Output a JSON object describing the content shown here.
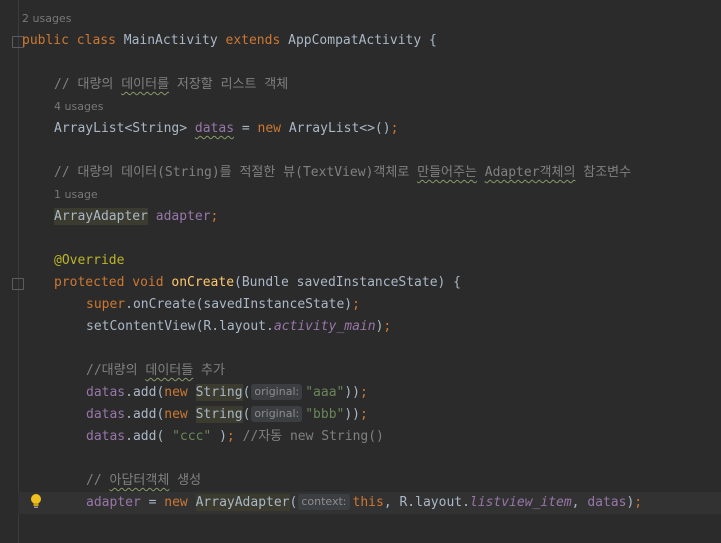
{
  "editor": {
    "lines": [
      {
        "id": "class-usages",
        "text": "2 usages"
      },
      {
        "id": "class-decl",
        "tokens": [
          {
            "t": "public class ",
            "c": "kw"
          },
          {
            "t": "MainActivity ",
            "c": "cls"
          },
          {
            "t": "extends ",
            "c": "kw"
          },
          {
            "t": "AppCompatActivity {",
            "c": "cls"
          }
        ]
      },
      {
        "id": "comment-1",
        "tokens": [
          {
            "t": "// 대량의 ",
            "c": "comment"
          },
          {
            "t": "데이터를",
            "c": "comment squig"
          },
          {
            "t": " 저장할 리스트 객체",
            "c": "comment"
          }
        ]
      },
      {
        "id": "datas-usages",
        "text": "4 usages"
      },
      {
        "id": "datas-decl",
        "tokens": [
          {
            "t": "ArrayList<String> ",
            "c": "cls"
          },
          {
            "t": "datas",
            "c": "field squig"
          },
          {
            "t": " = ",
            "c": "cls"
          },
          {
            "t": "new ",
            "c": "kw"
          },
          {
            "t": "ArrayList<>()",
            "c": "cls"
          },
          {
            "t": ";",
            "c": "kw"
          }
        ]
      },
      {
        "id": "comment-2",
        "tokens": [
          {
            "t": "// 대량의 데이터(String)를 적절한 뷰(TextView)객체로 ",
            "c": "comment"
          },
          {
            "t": "만들어주는",
            "c": "comment squig"
          },
          {
            "t": " ",
            "c": "comment"
          },
          {
            "t": "Adapter객체의",
            "c": "comment squig"
          },
          {
            "t": " 참조변수",
            "c": "comment"
          }
        ]
      },
      {
        "id": "adapter-usages",
        "text": "1 usage"
      },
      {
        "id": "adapter-decl",
        "tokens": [
          {
            "t": "ArrayAdapter",
            "c": "cls hl"
          },
          {
            "t": " ",
            "c": "cls"
          },
          {
            "t": "adapter",
            "c": "field"
          },
          {
            "t": ";",
            "c": "kw"
          }
        ]
      },
      {
        "id": "override",
        "tokens": [
          {
            "t": "@Override",
            "c": "ann"
          }
        ]
      },
      {
        "id": "oncreate-decl",
        "tokens": [
          {
            "t": "protected void ",
            "c": "kw"
          },
          {
            "t": "onCreate",
            "c": "method"
          },
          {
            "t": "(Bundle savedInstanceState) {",
            "c": "cls"
          }
        ]
      },
      {
        "id": "super-call",
        "tokens": [
          {
            "t": "super",
            "c": "kw"
          },
          {
            "t": ".onCreate(savedInstanceState)",
            "c": "cls"
          },
          {
            "t": ";",
            "c": "kw"
          }
        ]
      },
      {
        "id": "set-content",
        "tokens": [
          {
            "t": "setContentView(R.layout.",
            "c": "cls"
          },
          {
            "t": "activity_main",
            "c": "field ital"
          },
          {
            "t": ")",
            "c": "cls"
          },
          {
            "t": ";",
            "c": "kw"
          }
        ]
      },
      {
        "id": "comment-3",
        "tokens": [
          {
            "t": "//대량의 ",
            "c": "comment"
          },
          {
            "t": "데이터들",
            "c": "comment squig"
          },
          {
            "t": " 추가",
            "c": "comment"
          }
        ]
      },
      {
        "id": "add-aaa",
        "tokens": [
          {
            "t": "datas",
            "c": "field"
          },
          {
            "t": ".add(",
            "c": "cls"
          },
          {
            "t": "new ",
            "c": "kw"
          },
          {
            "t": "String",
            "c": "cls hl"
          },
          {
            "t": "(",
            "c": "cls"
          },
          {
            "hint": "original:"
          },
          {
            "t": "\"aaa\"",
            "c": "str"
          },
          {
            "t": "))",
            "c": "cls"
          },
          {
            "t": ";",
            "c": "kw"
          }
        ]
      },
      {
        "id": "add-bbb",
        "tokens": [
          {
            "t": "datas",
            "c": "field"
          },
          {
            "t": ".add(",
            "c": "cls"
          },
          {
            "t": "new ",
            "c": "kw"
          },
          {
            "t": "String",
            "c": "cls hl"
          },
          {
            "t": "(",
            "c": "cls"
          },
          {
            "hint": "original:"
          },
          {
            "t": "\"bbb\"",
            "c": "str"
          },
          {
            "t": "))",
            "c": "cls"
          },
          {
            "t": ";",
            "c": "kw"
          }
        ]
      },
      {
        "id": "add-ccc",
        "tokens": [
          {
            "t": "datas",
            "c": "field"
          },
          {
            "t": ".add( ",
            "c": "cls"
          },
          {
            "t": "\"ccc\"",
            "c": "str"
          },
          {
            "t": " )",
            "c": "cls"
          },
          {
            "t": "; ",
            "c": "kw"
          },
          {
            "t": "//자동 new String()",
            "c": "comment"
          }
        ]
      },
      {
        "id": "comment-4",
        "tokens": [
          {
            "t": "// ",
            "c": "comment"
          },
          {
            "t": "아답터객체",
            "c": "comment squig"
          },
          {
            "t": " 생성",
            "c": "comment"
          }
        ]
      },
      {
        "id": "adapter-create",
        "tokens": [
          {
            "t": "adapter",
            "c": "field"
          },
          {
            "t": " = ",
            "c": "cls"
          },
          {
            "t": "new ",
            "c": "kw"
          },
          {
            "t": "ArrayAdapter",
            "c": "cls hl"
          },
          {
            "t": "(",
            "c": "cls"
          },
          {
            "hint": "context:"
          },
          {
            "t": "this",
            "c": "kw"
          },
          {
            "t": ", R.layout.",
            "c": "cls"
          },
          {
            "t": "listview_item",
            "c": "field ital"
          },
          {
            "t": ", ",
            "c": "cls"
          },
          {
            "t": "datas",
            "c": "field"
          },
          {
            "t": ")",
            "c": "cls"
          },
          {
            "t": ";",
            "c": "kw"
          }
        ]
      }
    ]
  },
  "colors": {
    "background": "#2b2b2b",
    "keyword": "#cc7832",
    "field": "#9876aa",
    "comment": "#808080",
    "string": "#6a8759",
    "annotation": "#bbb529",
    "method": "#ffc66d"
  },
  "icons": {
    "intention": "lightbulb-icon",
    "fold": "fold-marker-icon"
  }
}
